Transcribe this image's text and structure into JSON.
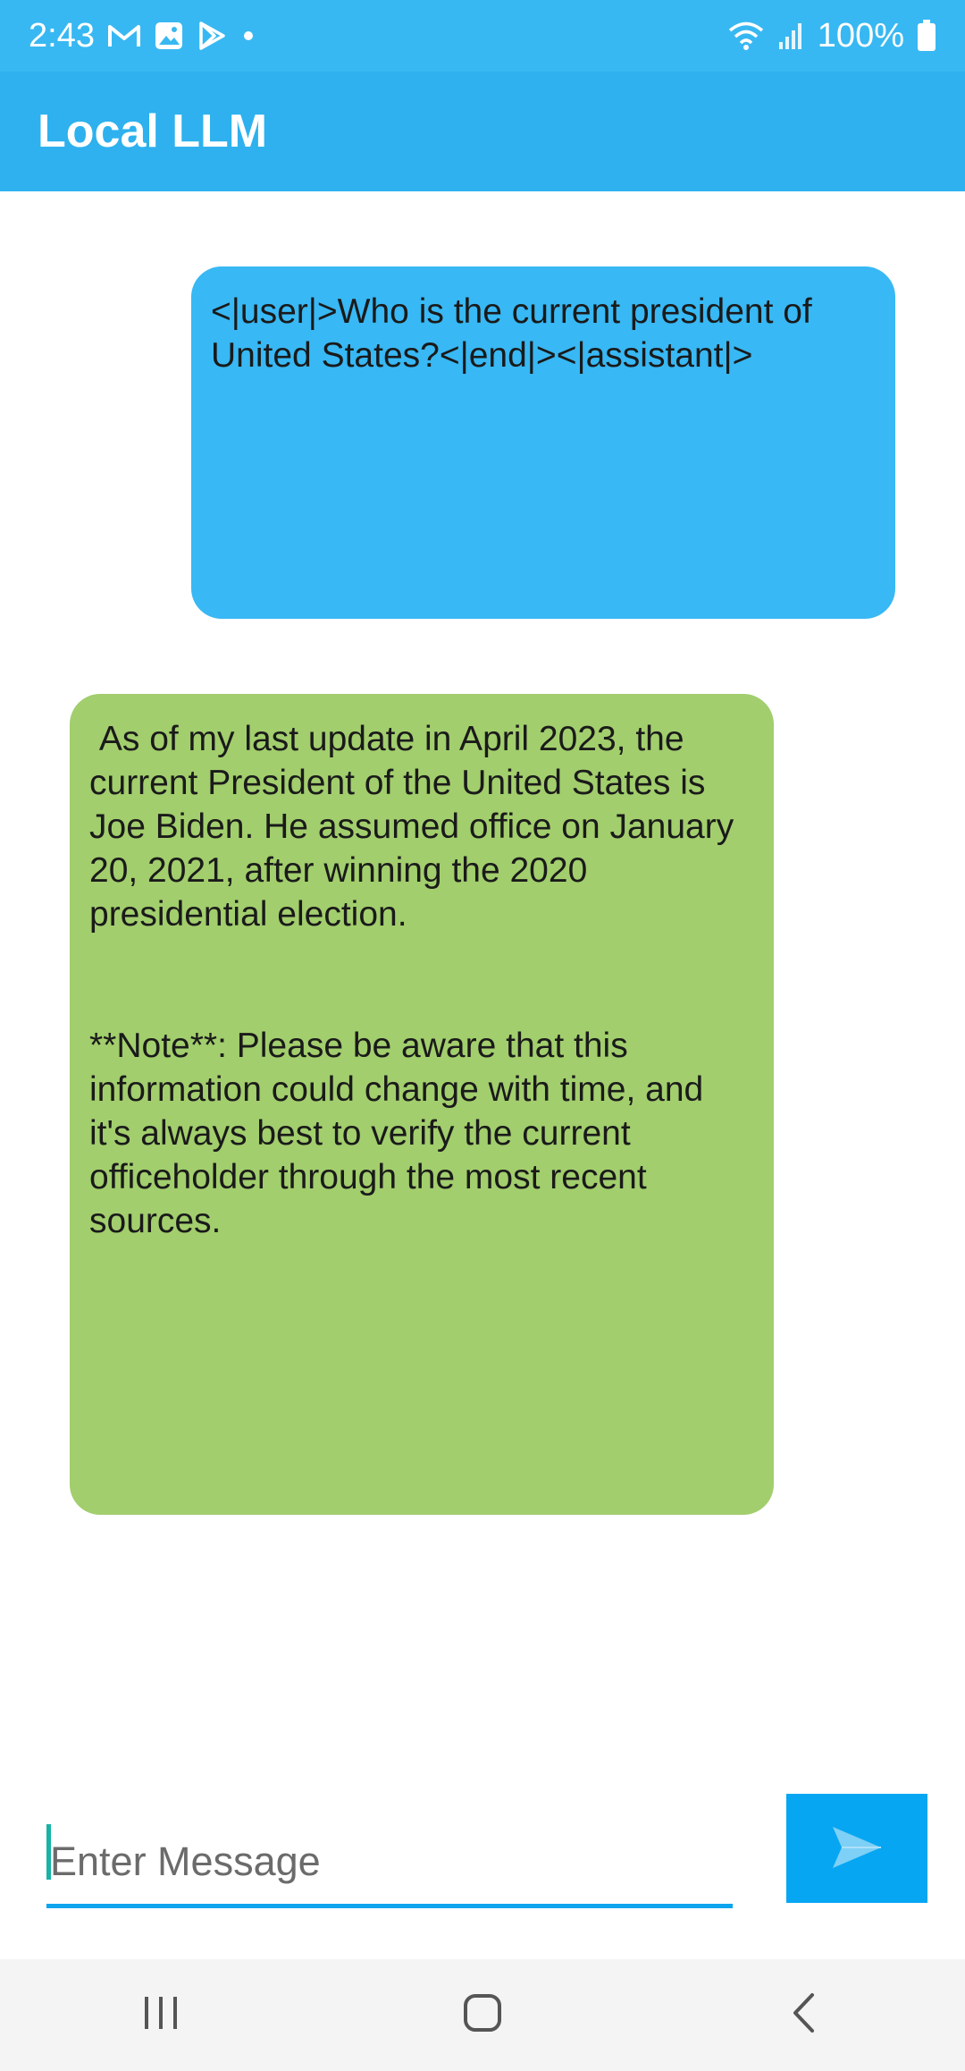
{
  "status_bar": {
    "time": "2:43",
    "icons": [
      "gmail-icon",
      "gallery-icon",
      "play-store-icon",
      "dot-icon"
    ],
    "right_icons": [
      "wifi-icon",
      "signal-icon"
    ],
    "battery": "100%"
  },
  "app_bar": {
    "title": "Local LLM"
  },
  "messages": [
    {
      "role": "user",
      "text": "<|user|>Who is the current president of United States?<|end|><|assistant|>"
    },
    {
      "role": "assistant",
      "text": " As of my last update in April 2023, the current President of the United States is Joe Biden. He assumed office on January 20, 2021, after winning the 2020 presidential election.\n\n\n**Note**: Please be aware that this information could change with time, and it's always best to verify the current officeholder through the most recent sources."
    }
  ],
  "input": {
    "placeholder": "Enter Message",
    "value": ""
  },
  "send_button": {
    "icon": "send-icon"
  },
  "nav_bar": {
    "buttons": [
      "recents-icon",
      "home-icon",
      "back-icon"
    ]
  },
  "colors": {
    "status_bar": "#38b8f2",
    "app_bar": "#2eb1ee",
    "user_bubble": "#38b8f4",
    "assistant_bubble": "#a2ce6d",
    "send_button": "#07a6f2"
  }
}
